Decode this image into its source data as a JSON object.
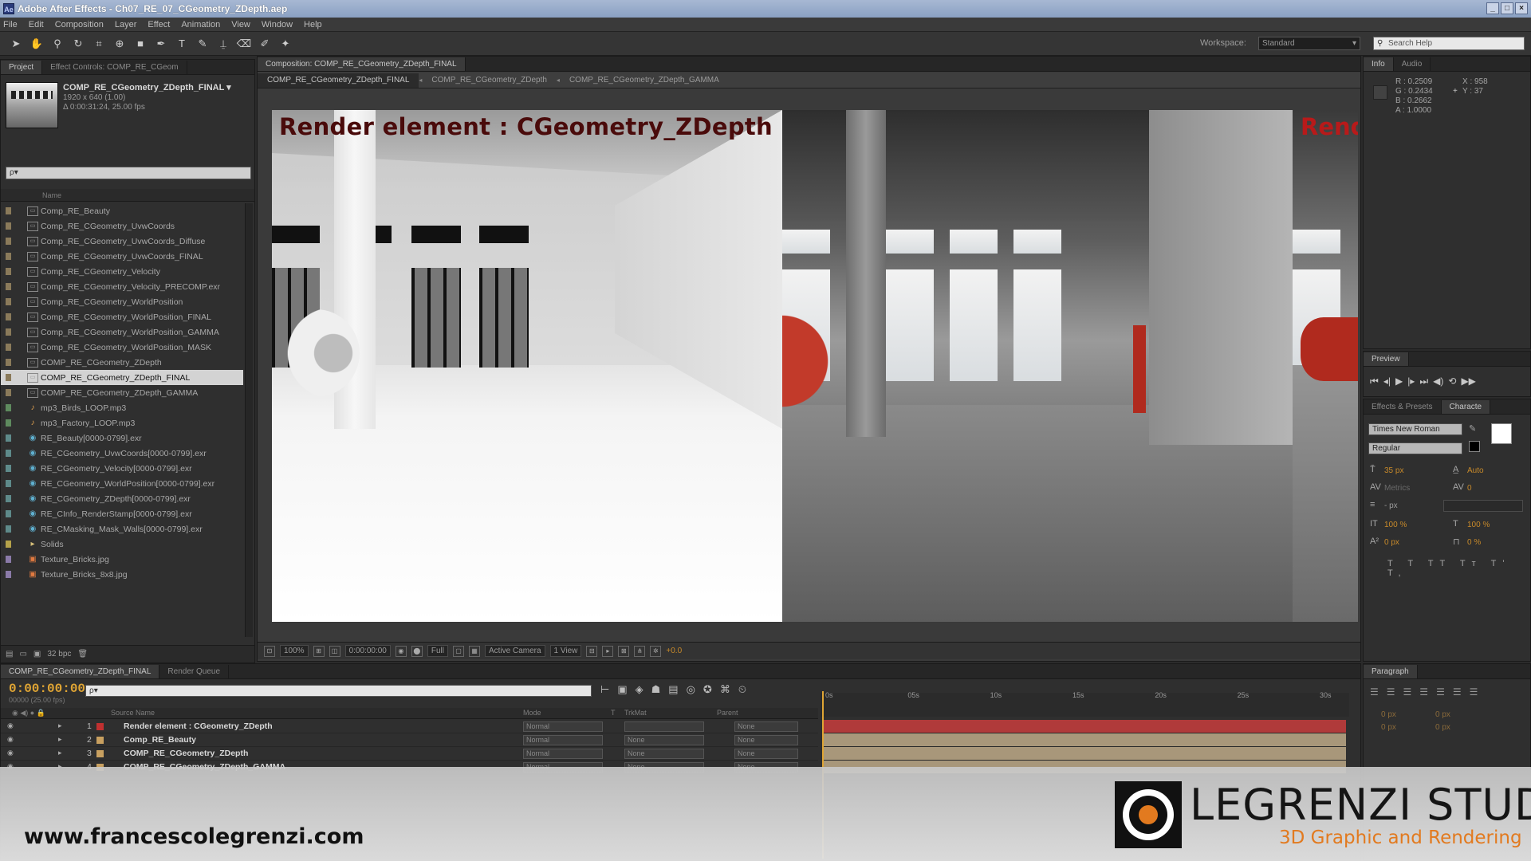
{
  "window": {
    "title": "Adobe After Effects - Ch07_RE_07_CGeometry_ZDepth.aep",
    "app_icon": "Ae"
  },
  "menu": [
    "File",
    "Edit",
    "Composition",
    "Layer",
    "Effect",
    "Animation",
    "View",
    "Window",
    "Help"
  ],
  "toolbar": {
    "tools": [
      "selection-tool",
      "hand-tool",
      "zoom-tool",
      "rotation-tool",
      "camera-tool",
      "pan-behind-tool",
      "mask-tool",
      "pen-tool",
      "type-tool",
      "brush-tool",
      "clone-stamp-tool",
      "eraser-tool",
      "roto-brush-tool",
      "puppet-tool"
    ],
    "workspace_label": "Workspace:",
    "workspace_value": "Standard",
    "search_placeholder": "Search Help"
  },
  "project_panel": {
    "tabs": [
      "Project",
      "Effect Controls: COMP_RE_CGeom"
    ],
    "selected_name": "COMP_RE_CGeometry_ZDepth_FINAL ▾",
    "selected_dims": "1920 x 640 (1.00)",
    "selected_duration": "Δ 0:00:31:24, 25.00 fps",
    "search_placeholder": "ρ▾",
    "column_name": "Name",
    "items": [
      {
        "name": "Comp_RE_Beauty",
        "type": "comp",
        "swatch": "#8a7a5a"
      },
      {
        "name": "Comp_RE_CGeometry_UvwCoords",
        "type": "comp",
        "swatch": "#8a7a5a"
      },
      {
        "name": "Comp_RE_CGeometry_UvwCoords_Diffuse",
        "type": "comp",
        "swatch": "#8a7a5a"
      },
      {
        "name": "Comp_RE_CGeometry_UvwCoords_FINAL",
        "type": "comp",
        "swatch": "#8a7a5a"
      },
      {
        "name": "Comp_RE_CGeometry_Velocity",
        "type": "comp",
        "swatch": "#8a7a5a"
      },
      {
        "name": "Comp_RE_CGeometry_Velocity_PRECOMP.exr",
        "type": "comp",
        "swatch": "#8a7a5a"
      },
      {
        "name": "Comp_RE_CGeometry_WorldPosition",
        "type": "comp",
        "swatch": "#8a7a5a"
      },
      {
        "name": "Comp_RE_CGeometry_WorldPosition_FINAL",
        "type": "comp",
        "swatch": "#8a7a5a"
      },
      {
        "name": "Comp_RE_CGeometry_WorldPosition_GAMMA",
        "type": "comp",
        "swatch": "#8a7a5a"
      },
      {
        "name": "Comp_RE_CGeometry_WorldPosition_MASK",
        "type": "comp",
        "swatch": "#8a7a5a"
      },
      {
        "name": "COMP_RE_CGeometry_ZDepth",
        "type": "comp",
        "swatch": "#8a7a5a"
      },
      {
        "name": "COMP_RE_CGeometry_ZDepth_FINAL",
        "type": "comp",
        "swatch": "#8a7a5a",
        "selected": true
      },
      {
        "name": "COMP_RE_CGeometry_ZDepth_GAMMA",
        "type": "comp",
        "swatch": "#8a7a5a"
      },
      {
        "name": "mp3_Birds_LOOP.mp3",
        "type": "audio",
        "swatch": "#5e8a5e"
      },
      {
        "name": "mp3_Factory_LOOP.mp3",
        "type": "audio",
        "swatch": "#5e8a5e"
      },
      {
        "name": "RE_Beauty[0000-0799].exr",
        "type": "seq",
        "swatch": "#5e8a8a"
      },
      {
        "name": "RE_CGeometry_UvwCoords[0000-0799].exr",
        "type": "seq",
        "swatch": "#5e8a8a"
      },
      {
        "name": "RE_CGeometry_Velocity[0000-0799].exr",
        "type": "seq",
        "swatch": "#5e8a8a"
      },
      {
        "name": "RE_CGeometry_WorldPosition[0000-0799].exr",
        "type": "seq",
        "swatch": "#5e8a8a"
      },
      {
        "name": "RE_CGeometry_ZDepth[0000-0799].exr",
        "type": "seq",
        "swatch": "#5e8a8a"
      },
      {
        "name": "RE_CInfo_RenderStamp[0000-0799].exr",
        "type": "seq",
        "swatch": "#5e8a8a"
      },
      {
        "name": "RE_CMasking_Mask_Walls[0000-0799].exr",
        "type": "seq",
        "swatch": "#5e8a8a"
      },
      {
        "name": "Solids",
        "type": "folder",
        "swatch": "#b5a24a"
      },
      {
        "name": "Texture_Bricks.jpg",
        "type": "img",
        "swatch": "#8a7aa8"
      },
      {
        "name": "Texture_Bricks_8x8.jpg",
        "type": "img",
        "swatch": "#8a7aa8"
      }
    ],
    "footer_bpc": "32 bpc"
  },
  "composition": {
    "tab_label": "Composition: COMP_RE_CGeometry_ZDepth_FINAL",
    "breadcrumbs": [
      "COMP_RE_CGeometry_ZDepth_FINAL",
      "COMP_RE_CGeometry_ZDepth",
      "COMP_RE_CGeometry_ZDepth_GAMMA"
    ],
    "overlay_label": "Render element : CGeometry_ZDepth",
    "overlay_label_right": "Rend",
    "footer": {
      "zoom": "100%",
      "timecode": "0:00:00:00",
      "resolution": "Full",
      "camera": "Active Camera",
      "views": "1 View",
      "exposure": "+0.0"
    }
  },
  "info_panel": {
    "tabs": [
      "Info",
      "Audio"
    ],
    "r": "R : 0.2509",
    "g": "G : 0.2434",
    "b": "B : 0.2662",
    "a": "A : 1.0000",
    "x": "X : 958",
    "y": "Y : 37"
  },
  "preview_panel": {
    "tab": "Preview",
    "controls": [
      "first-frame-icon",
      "prev-frame-icon",
      "play-icon",
      "next-frame-icon",
      "last-frame-icon",
      "audio-icon",
      "loop-icon",
      "ram-preview-icon"
    ]
  },
  "character_panel": {
    "tabs": [
      "Effects & Presets",
      "Characte"
    ],
    "font": "Times New Roman",
    "style": "Regular",
    "size": "35 px",
    "leading": "Auto",
    "kerning": "Metrics",
    "tracking": "0",
    "stroke": "- px",
    "vscale": "100 %",
    "hscale": "100 %",
    "baseline": "0 px",
    "tsume": "0 %",
    "styles_row": "T T TT Tт T' T,"
  },
  "timeline": {
    "tabs": [
      "COMP_RE_CGeometry_ZDepth_FINAL",
      "Render Queue"
    ],
    "timecode": "0:00:00:00",
    "subtime": "00000 (25.00 fps)",
    "search_placeholder": "ρ▾",
    "header": {
      "source_name": "Source Name",
      "mode": "Mode",
      "t": "T",
      "trkmat": "TrkMat",
      "parent": "Parent"
    },
    "ruler_ticks": [
      "0s",
      "05s",
      "10s",
      "15s",
      "20s",
      "25s",
      "30s"
    ],
    "layers": [
      {
        "num": "1",
        "name": "Render element : CGeometry_ZDepth",
        "swatch": "#c03030",
        "mode": "Normal",
        "trk": "",
        "parent": "None",
        "bar": "#b03a3a"
      },
      {
        "num": "2",
        "name": "Comp_RE_Beauty",
        "swatch": "#c8a060",
        "mode": "Normal",
        "trk": "None",
        "parent": "None",
        "bar": "#a8977a"
      },
      {
        "num": "3",
        "name": "COMP_RE_CGeometry_ZDepth",
        "swatch": "#c8a060",
        "mode": "Normal",
        "trk": "None",
        "parent": "None",
        "bar": "#a8977a"
      },
      {
        "num": "4",
        "name": "COMP_RE_CGeometry_ZDepth_GAMMA",
        "swatch": "#c8a060",
        "mode": "Normal",
        "trk": "None",
        "parent": "None",
        "bar": "#a8977a"
      }
    ]
  },
  "paragraph_panel": {
    "tab": "Paragraph",
    "indent_left": "0 px",
    "indent_right": "0 px",
    "space_before": "0 px",
    "space_after": "0 px"
  },
  "branding": {
    "url": "www.francescolegrenzi.com",
    "studio": "LEGRENZI STUDIO",
    "tagline": "3D Graphic and Rendering"
  }
}
